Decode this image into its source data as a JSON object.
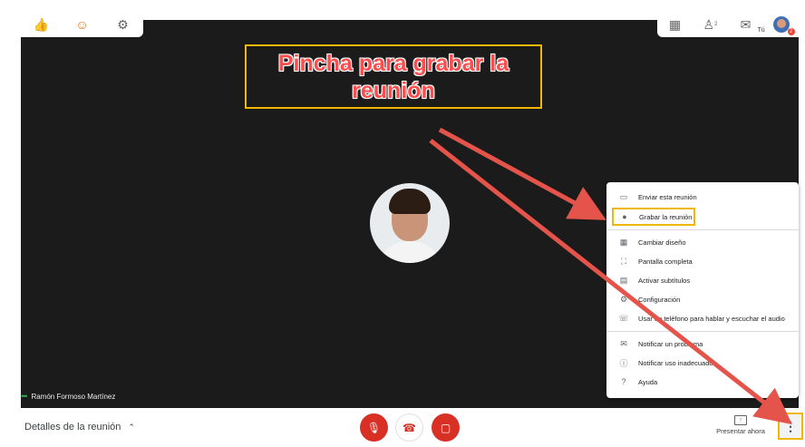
{
  "top_toolbar": {
    "left_icons": [
      "thumbs-up-icon",
      "emoji-face-icon",
      "gear-icon"
    ],
    "right_icons": [
      "grid-layout-icon",
      "people-icon",
      "chat-icon"
    ],
    "people_count": "2",
    "you_label": "Tú",
    "notification_count": "2"
  },
  "annotation": {
    "callout_text": "Pincha para grabar la reunión",
    "accent_color": "#f2b705",
    "text_color": "#ff4d4d",
    "arrow_color": "#e5544a"
  },
  "participant": {
    "name": "Ramón Formoso Martínez"
  },
  "bottom_bar": {
    "details_label": "Detalles de la reunión",
    "present_label": "Presentar ahora",
    "controls": [
      "mic-off",
      "hang-up",
      "camera-off"
    ]
  },
  "menu": {
    "items": [
      {
        "icon": "cast-icon",
        "label": "Enviar esta reunión"
      },
      {
        "icon": "record-icon",
        "label": "Grabar la reunión",
        "highlighted": true
      },
      {
        "icon": "layout-icon",
        "label": "Cambiar diseño"
      },
      {
        "icon": "fullscreen-icon",
        "label": "Pantalla completa"
      },
      {
        "icon": "captions-icon",
        "label": "Activar subtítulos"
      },
      {
        "icon": "gear-icon",
        "label": "Configuración"
      },
      {
        "icon": "phone-icon",
        "label": "Usar un teléfono para hablar y escuchar el audio"
      },
      {
        "icon": "report-problem-icon",
        "label": "Notificar un problema"
      },
      {
        "icon": "report-abuse-icon",
        "label": "Notificar uso inadecuado"
      },
      {
        "icon": "help-icon",
        "label": "Ayuda"
      }
    ]
  }
}
